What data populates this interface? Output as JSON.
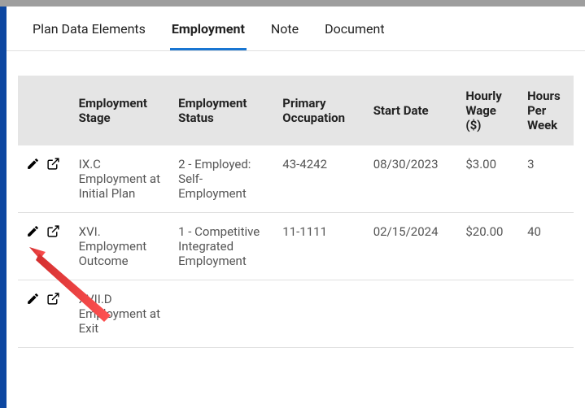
{
  "tabs": [
    {
      "label": "Plan Data Elements",
      "active": false
    },
    {
      "label": "Employment",
      "active": true
    },
    {
      "label": "Note",
      "active": false
    },
    {
      "label": "Document",
      "active": false
    }
  ],
  "columns": {
    "stage": "Employment Stage",
    "status": "Employment Status",
    "occupation": "Primary Occupation",
    "start": "Start Date",
    "wage": "Hourly Wage ($)",
    "hours": "Hours Per Week"
  },
  "rows": [
    {
      "stage": "IX.C Employment at Initial Plan",
      "status": "2 - Employed: Self-Employment",
      "occupation": "43-4242",
      "start": "08/30/2023",
      "wage": "$3.00",
      "hours": "3"
    },
    {
      "stage": "XVI. Employment Outcome",
      "status": "1 - Competitive Integrated Employment",
      "occupation": "11-1111",
      "start": "02/15/2024",
      "wage": "$20.00",
      "hours": "40"
    },
    {
      "stage": "XVII.D Employment at Exit",
      "status": "",
      "occupation": "",
      "start": "",
      "wage": "",
      "hours": ""
    }
  ]
}
